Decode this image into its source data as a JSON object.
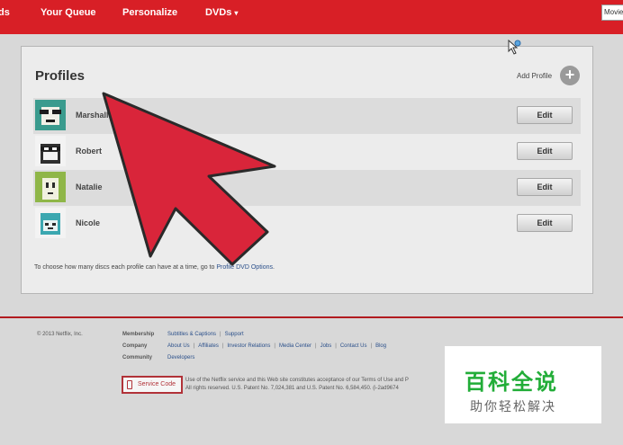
{
  "nav": {
    "items": [
      "ds",
      "Your Queue",
      "Personalize",
      "DVDs"
    ],
    "dvds_caret": "▾",
    "search_value": "Movies"
  },
  "panel": {
    "title": "Profiles",
    "add_profile_label": "Add Profile",
    "add_symbol": "+",
    "profiles": [
      {
        "name": "Marshall",
        "edit": "Edit"
      },
      {
        "name": "Robert",
        "edit": "Edit"
      },
      {
        "name": "Natalie",
        "edit": "Edit"
      },
      {
        "name": "Nicole",
        "edit": "Edit"
      }
    ],
    "note_text": "To choose how many discs each profile can have at a time, go to ",
    "note_link": "Profile DVD Options",
    "note_end": "."
  },
  "footer": {
    "copyright": "© 2013 Netflix, Inc.",
    "membership_label": "Membership",
    "membership_links": [
      "Subtitles & Captions",
      "Support"
    ],
    "company_label": "Company",
    "company_links": [
      "About Us",
      "Affiliates",
      "Investor Relations",
      "Media Center",
      "Jobs",
      "Contact Us",
      "Blog"
    ],
    "community_label": "Community",
    "community_links": [
      "Developers"
    ],
    "service_code": "Service Code",
    "legal_line1": "Use of the Netflix service and this Web site constitutes acceptance of our Terms of Use and P",
    "legal_line2": "All rights reserved.    U.S. Patent No. 7,024,381 and U.S. Patent No. 6,584,450. (i-2ad9674"
  },
  "watermark": {
    "title": "百科全说",
    "subtitle": "助你轻松解决"
  },
  "colors": {
    "brand_red": "#d81f26",
    "annotation_arrow": "#d9253a",
    "watermark_green": "#22ad38"
  }
}
